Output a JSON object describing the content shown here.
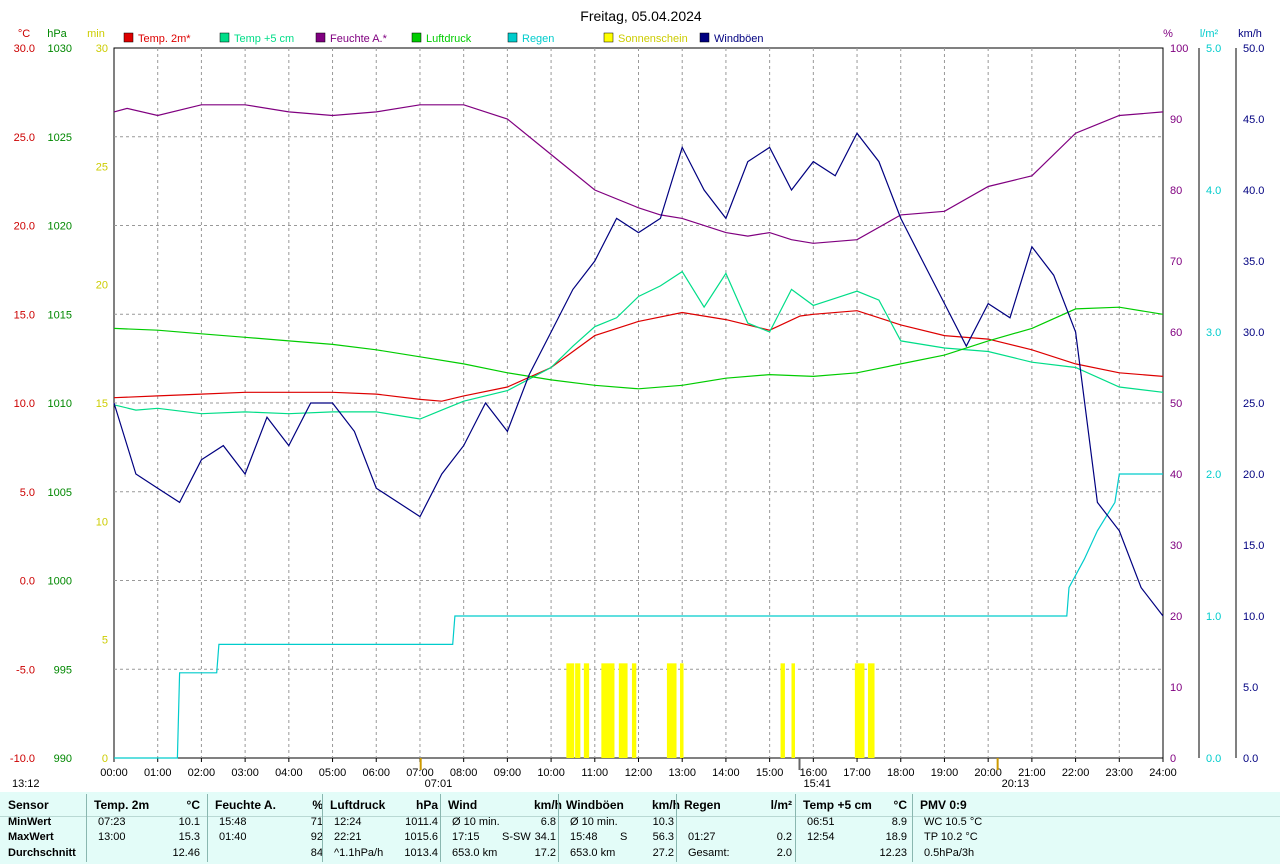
{
  "chart_data": {
    "type": "line",
    "title": "Freitag, 05.04.2024",
    "x_range": [
      "00:00",
      "24:00"
    ],
    "x_ticks": [
      "00:00",
      "01:00",
      "02:00",
      "03:00",
      "04:00",
      "05:00",
      "06:00",
      "07:00",
      "08:00",
      "09:00",
      "10:00",
      "11:00",
      "12:00",
      "13:00",
      "14:00",
      "15:00",
      "16:00",
      "17:00",
      "18:00",
      "19:00",
      "20:00",
      "21:00",
      "22:00",
      "23:00",
      "24:00"
    ],
    "axes": {
      "temp": {
        "unit": "°C",
        "range": [
          -10,
          30
        ],
        "ticks": [
          "30.0",
          "25.0",
          "20.0",
          "15.0",
          "10.0",
          "5.0",
          "0.0",
          "-5.0",
          "-10.0"
        ],
        "color": "#cc0000"
      },
      "pressure": {
        "unit": "hPa",
        "range": [
          990,
          1030
        ],
        "ticks": [
          "1030",
          "1025",
          "1020",
          "1015",
          "1010",
          "1005",
          "1000",
          "995",
          "990"
        ],
        "color": "#008800"
      },
      "sun_min": {
        "unit": "min",
        "range": [
          0,
          30
        ],
        "ticks": [
          "30",
          "25",
          "20",
          "15",
          "10",
          "5",
          "0"
        ],
        "color": "#cccc00"
      },
      "humidity": {
        "unit": "%",
        "range": [
          0,
          100
        ],
        "ticks": [
          "100",
          "90",
          "80",
          "70",
          "60",
          "50",
          "40",
          "30",
          "20",
          "10",
          "0"
        ],
        "color": "#800080"
      },
      "rain": {
        "unit": "l/m²",
        "range": [
          0,
          5
        ],
        "ticks": [
          "5.0",
          "4.0",
          "3.0",
          "2.0",
          "1.0",
          "0.0"
        ],
        "color": "#00cccc"
      },
      "wind": {
        "unit": "km/h",
        "range": [
          0,
          50
        ],
        "ticks": [
          "50.0",
          "45.0",
          "40.0",
          "35.0",
          "30.0",
          "25.0",
          "20.0",
          "15.0",
          "10.0",
          "5.0",
          "0.0"
        ],
        "color": "#000080"
      }
    },
    "legend_position": "top",
    "grid": true,
    "series": [
      {
        "name": "Temp. 2m*",
        "color": "#dd0000",
        "axis": "temp",
        "x": [
          0,
          1,
          2,
          3,
          4,
          5,
          6,
          7,
          7.5,
          8,
          9,
          10,
          11,
          12,
          13,
          14,
          15,
          15.7,
          16,
          17,
          18,
          19,
          20,
          21,
          22,
          23,
          24
        ],
        "y": [
          10.3,
          10.4,
          10.5,
          10.6,
          10.6,
          10.6,
          10.5,
          10.2,
          10.1,
          10.4,
          10.9,
          12.0,
          13.8,
          14.6,
          15.1,
          14.7,
          14.1,
          14.9,
          15.0,
          15.2,
          14.4,
          13.8,
          13.6,
          13.0,
          12.2,
          11.7,
          11.5
        ]
      },
      {
        "name": "Temp +5 cm",
        "color": "#00dd88",
        "axis": "temp",
        "x": [
          0,
          0.5,
          1,
          2,
          3,
          4,
          5,
          6,
          7,
          7.5,
          8,
          9,
          10,
          10.5,
          11,
          11.5,
          12,
          12.5,
          13,
          13.5,
          14,
          14.5,
          15,
          15.5,
          16,
          16.5,
          17,
          17.5,
          18,
          19,
          20,
          21,
          22,
          23,
          24
        ],
        "y": [
          9.9,
          9.6,
          9.7,
          9.4,
          9.5,
          9.4,
          9.5,
          9.5,
          9.1,
          9.6,
          10.1,
          10.7,
          12.0,
          13.2,
          14.3,
          14.8,
          16.0,
          16.6,
          17.4,
          15.4,
          17.3,
          14.5,
          14.0,
          16.4,
          15.5,
          15.9,
          16.3,
          15.8,
          13.5,
          13.1,
          12.9,
          12.3,
          12.0,
          10.9,
          10.6
        ]
      },
      {
        "name": "Feuchte A.*",
        "color": "#800080",
        "axis": "humidity",
        "x": [
          0,
          0.3,
          1,
          2,
          3,
          4,
          5,
          6,
          7,
          8,
          9,
          10,
          11,
          12,
          12.5,
          13,
          14,
          14.5,
          15,
          15.5,
          16,
          17,
          18,
          19,
          20,
          21,
          22,
          23,
          24
        ],
        "y": [
          91,
          91.5,
          90.5,
          92,
          92,
          91,
          90.5,
          91,
          92,
          92,
          90,
          85,
          80,
          77.5,
          76.5,
          76,
          74,
          73.5,
          74,
          73,
          72.5,
          73,
          76.5,
          77,
          80.5,
          82,
          88,
          90.5,
          91
        ]
      },
      {
        "name": "Luftdruck",
        "color": "#00cc00",
        "axis": "pressure",
        "x": [
          0,
          1,
          2,
          3,
          4,
          5,
          6,
          7,
          8,
          9,
          10,
          11,
          12,
          13,
          14,
          15,
          16,
          17,
          18,
          19,
          20,
          21,
          22,
          23,
          24
        ],
        "y": [
          1014.2,
          1014.1,
          1013.9,
          1013.7,
          1013.5,
          1013.3,
          1013.0,
          1012.6,
          1012.2,
          1011.7,
          1011.3,
          1011.0,
          1010.8,
          1011.0,
          1011.4,
          1011.6,
          1011.5,
          1011.7,
          1012.2,
          1012.7,
          1013.5,
          1014.2,
          1015.3,
          1015.4,
          1015.0
        ]
      },
      {
        "name": "Regen",
        "color": "#00cccc",
        "axis": "rain",
        "x": [
          0,
          1.45,
          1.5,
          2.35,
          2.4,
          7.75,
          7.8,
          21.8,
          21.85,
          22.2,
          22.5,
          22.9,
          23.0,
          23.2,
          24
        ],
        "y": [
          0,
          0,
          0.6,
          0.6,
          0.8,
          0.8,
          1.0,
          1.0,
          1.2,
          1.4,
          1.6,
          1.8,
          2.0,
          2.0,
          2.0
        ]
      },
      {
        "name": "Sonnenschein",
        "color": "#ffff00",
        "axis": "sun_min",
        "x": [
          10.35,
          10.55,
          10.75,
          11.15,
          11.55,
          11.85,
          12.65,
          12.95,
          15.25,
          15.5,
          16.95,
          17.25
        ],
        "width": [
          0.18,
          0.12,
          0.12,
          0.3,
          0.2,
          0.1,
          0.22,
          0.08,
          0.1,
          0.08,
          0.22,
          0.15
        ],
        "y": [
          4,
          4,
          4,
          4,
          4,
          4,
          4,
          4,
          4,
          4,
          4,
          4
        ]
      },
      {
        "name": "Windböen",
        "color": "#000080",
        "axis": "wind",
        "x": [
          0,
          0.5,
          1,
          1.5,
          2,
          2.5,
          3,
          3.5,
          4,
          4.5,
          5,
          5.5,
          6,
          6.5,
          7,
          7.5,
          8,
          8.5,
          9,
          9.5,
          10,
          10.5,
          11,
          11.5,
          12,
          12.5,
          13,
          13.5,
          14,
          14.5,
          15,
          15.5,
          16,
          16.5,
          17,
          17.5,
          18,
          18.5,
          19,
          19.5,
          20,
          20.5,
          21,
          21.5,
          22,
          22.5,
          23,
          23.5,
          24
        ],
        "y": [
          25,
          20,
          19,
          18,
          21,
          22,
          20,
          24,
          22,
          25,
          25,
          23,
          19,
          18,
          17,
          20,
          22,
          25,
          23,
          27,
          30,
          33,
          35,
          38,
          37,
          38,
          43,
          40,
          38,
          42,
          43,
          40,
          42,
          41,
          44,
          42,
          38,
          35,
          32,
          29,
          32,
          31,
          36,
          34,
          30,
          18,
          16,
          12,
          10
        ]
      }
    ],
    "markers": {
      "sunrise": "07:01",
      "culmination": "15:41",
      "sunset": "20:13",
      "start": "13:12"
    }
  },
  "stats": {
    "row_labels": {
      "sensor": "Sensor",
      "min": "MinWert",
      "max": "MaxWert",
      "avg": "Durchschnitt"
    },
    "columns": [
      {
        "title": "Temp. 2m",
        "unit": "°C",
        "min_time": "07:23",
        "min_val": "10.1",
        "max_time": "13:00",
        "max_val": "15.3",
        "avg_val": "12.46"
      },
      {
        "title": "Feuchte A.",
        "unit": "%",
        "min_time": "15:48",
        "min_val": "71",
        "max_time": "01:40",
        "max_val": "92",
        "avg_val": "84"
      },
      {
        "title": "Luftdruck",
        "unit": "hPa",
        "min_time": "12:24",
        "min_val": "1011.4",
        "max_time": "22:21",
        "max_val": "1015.6",
        "avg_time": "^1.1hPa/h",
        "avg_val": "1013.4"
      },
      {
        "title": "Wind",
        "unit": "km/h",
        "min_time": "Ø 10 min.",
        "min_val": "6.8",
        "max_time": "17:15",
        "max_dir": "S-SW",
        "max_val": "34.1",
        "avg_time": "653.0 km",
        "avg_val": "17.2"
      },
      {
        "title": "Windböen",
        "unit": "km/h",
        "min_time": "Ø 10 min.",
        "min_val": "10.3",
        "max_time": "15:48",
        "max_dir": "S",
        "max_val": "56.3",
        "avg_time": "653.0 km",
        "avg_val": "27.2"
      },
      {
        "title": "Regen",
        "unit": "l/m²",
        "max_time": "01:27",
        "max_val": "0.2",
        "avg_time": "Gesamt:",
        "avg_val": "2.0"
      },
      {
        "title": "Temp +5 cm",
        "unit": "°C",
        "min_time": "06:51",
        "min_val": "8.9",
        "max_time": "12:54",
        "max_val": "18.9",
        "avg_val": "12.23"
      },
      {
        "title": "PMV 0:9",
        "min_time": "WC 10.5 °C",
        "max_time": "TP 10.2 °C",
        "avg_time": "0.5hPa/3h"
      }
    ]
  }
}
